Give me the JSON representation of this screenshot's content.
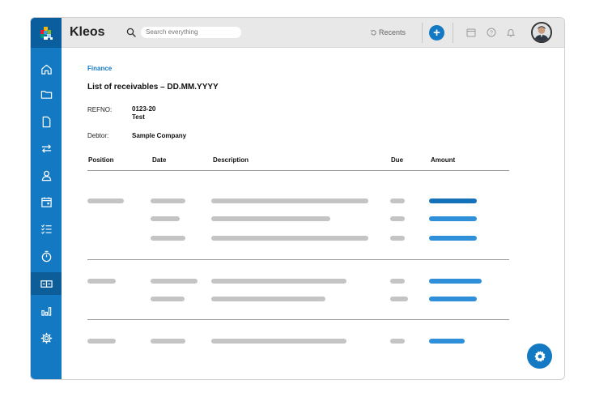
{
  "app": {
    "brand": "Kleos"
  },
  "search": {
    "placeholder": "Search everything"
  },
  "toolbar": {
    "recents_label": "Recents",
    "add_label": "+"
  },
  "sidebar": {
    "items": [
      {
        "name": "home",
        "icon": "home-icon"
      },
      {
        "name": "folders",
        "icon": "folder-icon"
      },
      {
        "name": "documents",
        "icon": "document-icon"
      },
      {
        "name": "transfers",
        "icon": "transfer-arrows-icon"
      },
      {
        "name": "contacts",
        "icon": "user-icon"
      },
      {
        "name": "calendar",
        "icon": "calendar-icon"
      },
      {
        "name": "tasks",
        "icon": "checklist-icon"
      },
      {
        "name": "time",
        "icon": "stopwatch-icon"
      },
      {
        "name": "finance",
        "icon": "finance-icon",
        "active": true
      },
      {
        "name": "reports",
        "icon": "bar-chart-icon"
      },
      {
        "name": "settings",
        "icon": "gear-icon"
      }
    ]
  },
  "page": {
    "breadcrumb": "Finance",
    "title": "List of receivables – DD.MM.YYYY",
    "refno_label": "REFNO:",
    "refno_value": "0123-20",
    "refno_sub": "Test",
    "debtor_label": "Debtor:",
    "debtor_value": "Sample Company"
  },
  "table": {
    "headers": [
      "Position",
      "Date",
      "Description",
      "Due",
      "Amount"
    ]
  },
  "colors": {
    "accent": "#1479c3",
    "sidebar": "#1479c3",
    "placeholder_bar": "#c4c4c4",
    "amount_bar": "#2f8fd8"
  }
}
